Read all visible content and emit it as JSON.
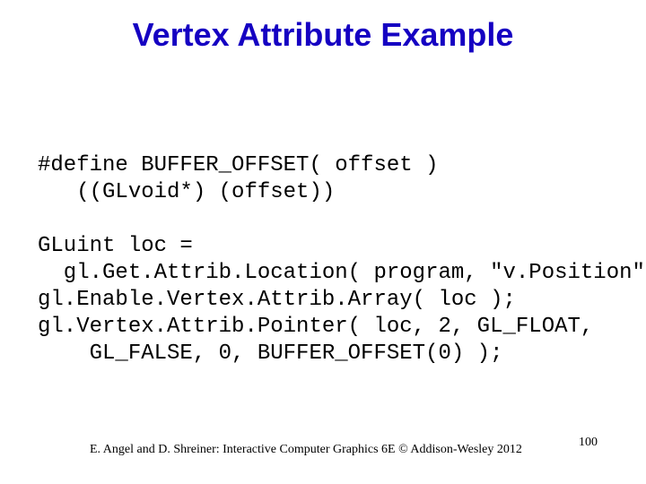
{
  "title": "Vertex Attribute Example",
  "code": "#define BUFFER_OFFSET( offset )\n   ((GLvoid*) (offset))\n\nGLuint loc =\n  gl.Get.Attrib.Location( program, \"v.Position\" );\ngl.Enable.Vertex.Attrib.Array( loc );\ngl.Vertex.Attrib.Pointer( loc, 2, GL_FLOAT,\n    GL_FALSE, 0, BUFFER_OFFSET(0) );",
  "footer": "E. Angel and D. Shreiner: Interactive Computer Graphics 6E © Addison-Wesley 2012",
  "page": "100"
}
